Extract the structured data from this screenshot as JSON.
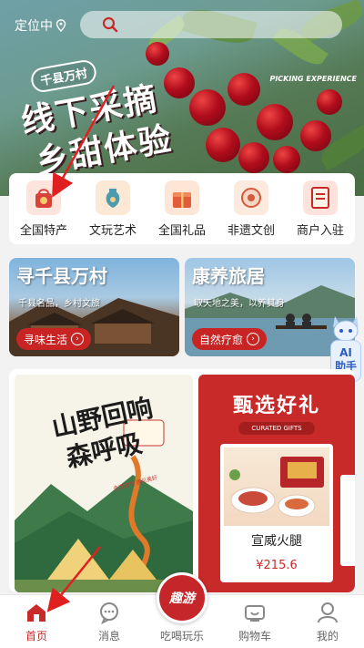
{
  "topbar": {
    "location_label": "定位中"
  },
  "hero": {
    "tag": "千县万村",
    "title_line1": "线下采摘",
    "title_line2": "乡甜体验",
    "brand_text": "PICKING EXPERIENCE"
  },
  "categories": [
    {
      "label": "全国特产",
      "icon": "specialty-bag-icon"
    },
    {
      "label": "文玩艺术",
      "icon": "art-vase-icon"
    },
    {
      "label": "全国礼品",
      "icon": "gift-box-icon"
    },
    {
      "label": "非遗文创",
      "icon": "heritage-lantern-icon"
    },
    {
      "label": "商户入驻",
      "icon": "merchant-entry-icon"
    }
  ],
  "promos": [
    {
      "title": "寻千县万村",
      "desc": "千县名品，乡村文旅",
      "button": "寻味生活"
    },
    {
      "title": "康养旅居",
      "desc": "取天地之美，以养其身",
      "button": "自然疗愈"
    }
  ],
  "ai_assistant": {
    "label_line1": "AI",
    "label_line2": "助手"
  },
  "showcase": {
    "poster": {
      "title_line1": "山野回响",
      "title_line2": "森呼吸",
      "note": "走进自然 遇见美好"
    },
    "featured": {
      "title": "甄选好礼",
      "subtitle": "CURATED GIFTS",
      "product_name": "宣威火腿",
      "price": "¥215.6"
    }
  },
  "bottom_nav": [
    {
      "label": "首页",
      "icon": "home-icon",
      "active": true
    },
    {
      "label": "消息",
      "icon": "message-icon",
      "active": false
    },
    {
      "label": "吃喝玩乐",
      "icon": "fun-center-icon",
      "active": false
    },
    {
      "label": "购物车",
      "icon": "cart-icon",
      "active": false
    },
    {
      "label": "我的",
      "icon": "profile-icon",
      "active": false
    }
  ],
  "center_button_text": "趣游",
  "colors": {
    "brand_red": "#c82a2a",
    "annotation_red": "#e02020"
  }
}
